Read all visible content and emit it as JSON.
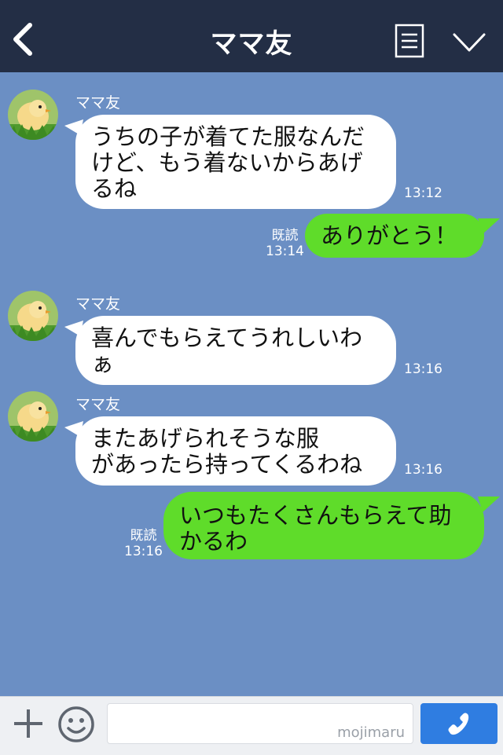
{
  "header": {
    "title": "ママ友"
  },
  "messages": [
    {
      "sender": "ママ友",
      "lines": [
        "うちの子が着てた服なんだ",
        "けど、もう着ないからあげ",
        "るね"
      ],
      "time": "13:12"
    },
    {
      "read": "既読",
      "time": "13:14",
      "lines": [
        "ありがとう！"
      ]
    },
    {
      "sender": "ママ友",
      "lines": [
        "喜んでもらえてうれしいわ",
        "ぁ"
      ],
      "time": "13:16"
    },
    {
      "sender": "ママ友",
      "lines": [
        "またあげられそうな服",
        "があったら持ってくるわね"
      ],
      "time": "13:16"
    },
    {
      "read": "既読",
      "time": "13:16",
      "lines": [
        "いつもたくさんもらえて助",
        "かるわ"
      ]
    }
  ],
  "input": {
    "watermark": "mojimaru"
  },
  "colors": {
    "header_bg": "#232e45",
    "chat_bg": "#6b8fc4",
    "outgoing_bubble": "#5fdc2a",
    "incoming_bubble": "#ffffff",
    "call_button": "#2f7de1"
  },
  "icons": {
    "back": "chevron-left-icon",
    "menu": "document-list-icon",
    "collapse": "chevron-down-icon",
    "add": "plus-icon",
    "emoji": "smiley-icon",
    "call": "phone-icon",
    "avatar": "chick-avatar-icon"
  }
}
